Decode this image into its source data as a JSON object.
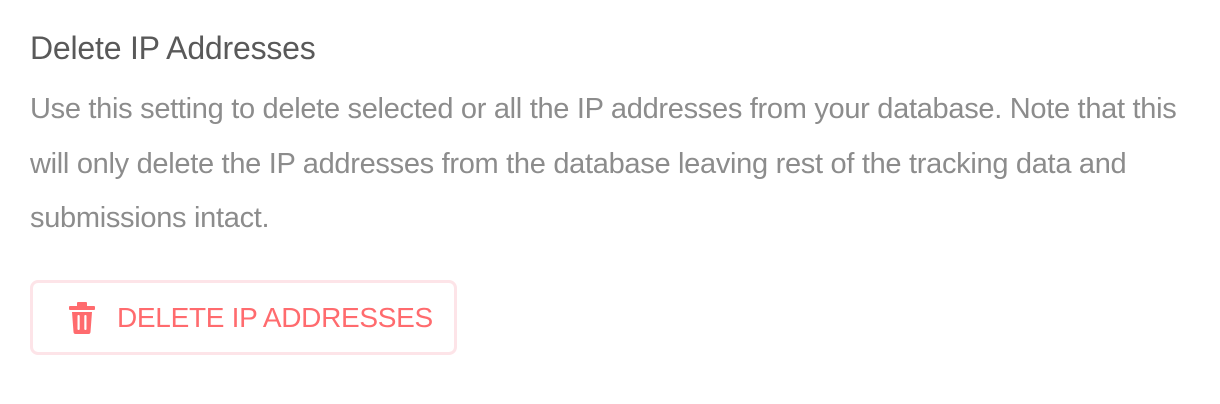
{
  "section": {
    "title": "Delete IP Addresses",
    "description": "Use this setting to delete selected or all the IP addresses from your database. Note that this will only delete the IP addresses from the database leaving rest of the tracking data and submissions intact."
  },
  "delete_button": {
    "label": "DELETE IP ADDRESSES",
    "icon": "trash-icon",
    "color": "#ff6b6e",
    "border_color": "#fde4e8"
  }
}
